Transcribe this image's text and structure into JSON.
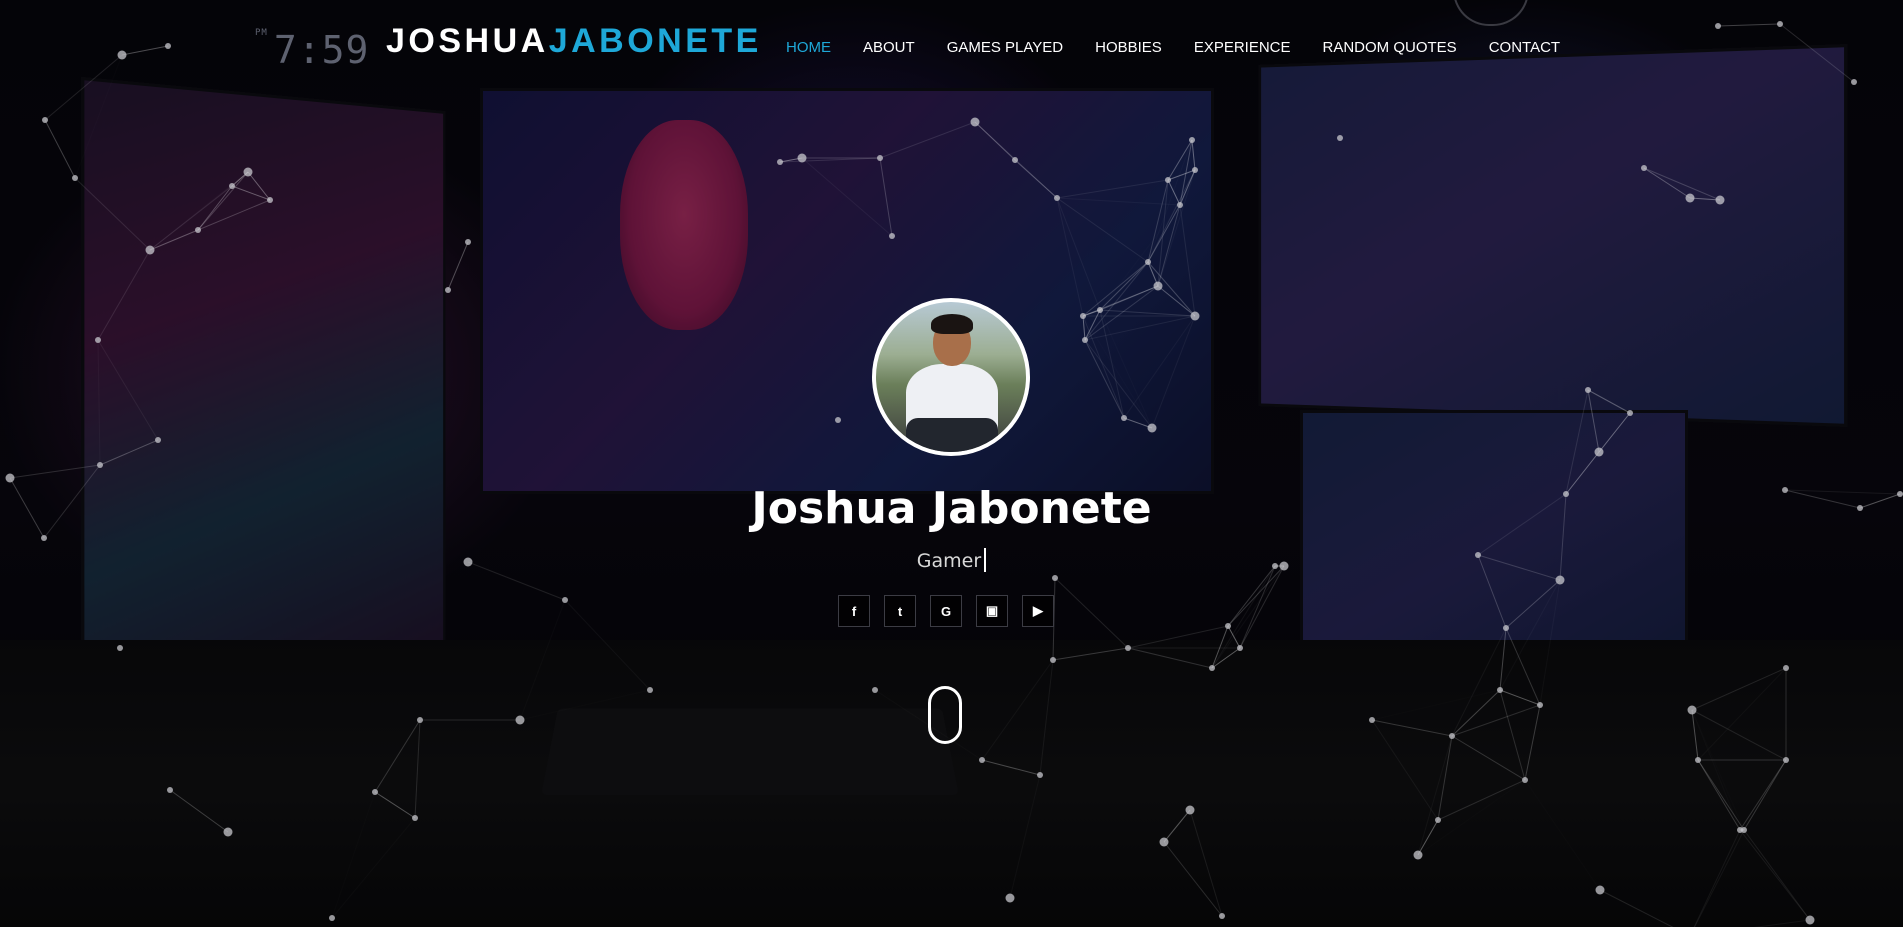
{
  "clock": {
    "meridiem": "PM",
    "time": "7:59"
  },
  "brand": {
    "first": "JOSHUA",
    "last": "JABONETE"
  },
  "nav": {
    "items": [
      {
        "label": "HOME",
        "active": true
      },
      {
        "label": "ABOUT",
        "active": false
      },
      {
        "label": "GAMES PLAYED",
        "active": false
      },
      {
        "label": "HOBBIES",
        "active": false
      },
      {
        "label": "EXPERIENCE",
        "active": false
      },
      {
        "label": "RANDOM QUOTES",
        "active": false
      },
      {
        "label": "CONTACT",
        "active": false
      }
    ]
  },
  "hero": {
    "name": "Joshua Jabonete",
    "subtitle": "Gamer"
  },
  "socials": [
    {
      "icon": "facebook-icon",
      "glyph": "f"
    },
    {
      "icon": "twitter-icon",
      "glyph": "t"
    },
    {
      "icon": "google-icon",
      "glyph": "G"
    },
    {
      "icon": "twitch-icon",
      "glyph": "▣"
    },
    {
      "icon": "youtube-icon",
      "glyph": "▶"
    }
  ],
  "colors": {
    "accent": "#1ea8d8",
    "text": "#ffffff",
    "background": "#050509"
  }
}
